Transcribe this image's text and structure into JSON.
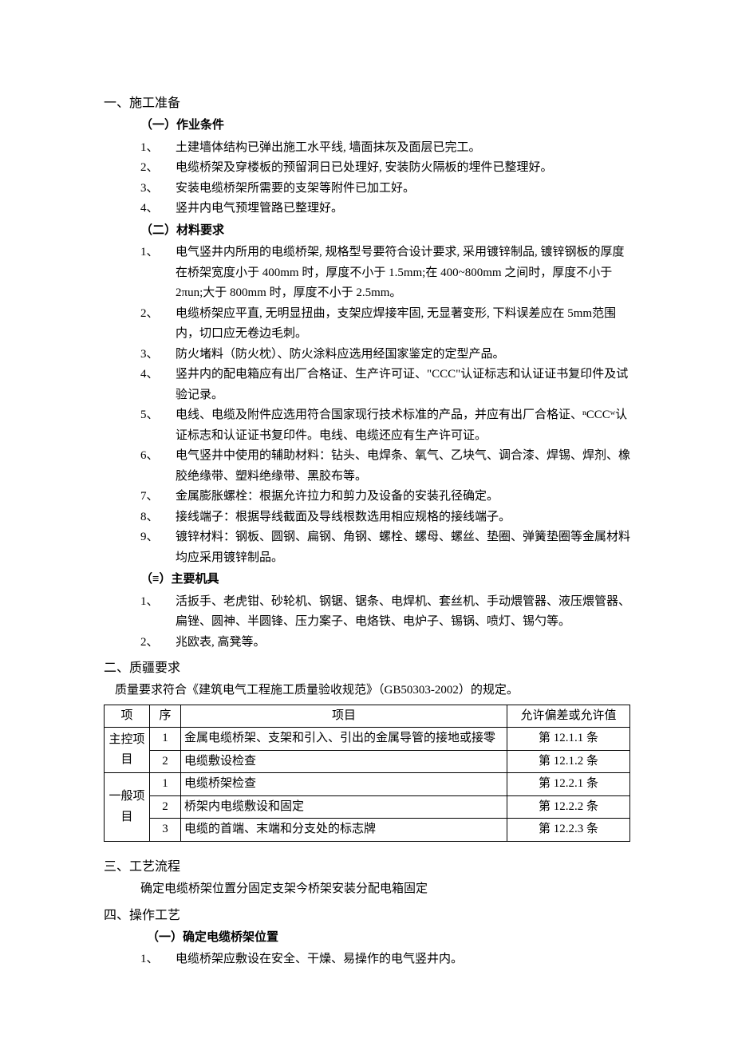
{
  "s1": {
    "title": "一、施工准备",
    "a": {
      "title": "（一）作业条件",
      "items": [
        "土建墙体结构已弹出施工水平线, 墙面抹灰及面层已完工。",
        "电缆桥架及穿楼板的预留洞日已处理好, 安装防火隔板的埋件已整理好。",
        "安装电缆桥架所需要的支架等附件已加工好。",
        "竖井内电气预埋管路已整理好。"
      ]
    },
    "b": {
      "title": "（二）材料要求",
      "items": [
        "电气竖井内所用的电缆桥架, 规格型号要符合设计要求, 采用镀锌制品, 镀锌钢板的厚度在桥架宽度小于 400mm 时，厚度不小于 1.5mm;在 400~800mm 之间时，厚度不小于 2πun;大于 800mm 时，厚度不小于 2.5mm。",
        "电缆桥架应平直, 无明显扭曲，支架应焊接牢固, 无显著变形, 下料误差应在 5mm范围内，切口应无卷边毛刺。",
        "防火堵料（防火枕）、防火涂料应选用经国家鉴定的定型产品。",
        "竖井内的配电箱应有出厂合格证、生产许可证、\"CCC\"认证标志和认证证书复印件及试验记录。",
        "电线、电缆及附件应选用符合国家现行技术标准的产品，并应有出厂合格证、ⁿCCCʷ认证标志和认证证书复印件。电线、电缆还应有生产许可证。",
        "电气竖井中使用的辅助材料：钻头、电焊条、氧气、乙块气、调合漆、焊锡、焊剂、橡胶绝缘带、塑料绝缘带、黑胶布等。",
        "金属膨胀螺栓：根据允许拉力和剪力及设备的安装孔径确定。",
        "接线端子：根据导线截面及导线根数选用相应规格的接线端子。",
        "镀锌材料：钢板、圆钢、扁钢、角钢、螺栓、螺母、螺丝、垫圈、弹簧垫圈等金属材料均应采用镀锌制品。"
      ]
    },
    "c": {
      "title": "（≡）主要机具",
      "items": [
        "活扳手、老虎钳、砂轮机、钢锯、锯条、电焊机、套丝机、手动煨管器、液压煨管器、扁锉、圆神、半圆锋、压力案子、电烙铁、电炉子、锡锅、喷灯、锡勺等。",
        "兆欧表, 高凳等。"
      ]
    }
  },
  "s2": {
    "title": "二、质疆要求",
    "note": "质量要求符合《建筑电气工程施工质量验收规范》（GB50303-2002）的规定。",
    "table": {
      "headers": [
        "项",
        "序",
        "项目",
        "允许偏差或允许值"
      ],
      "groups": [
        {
          "label": "主控项目",
          "rows": [
            [
              "1",
              "金属电缆桥架、支架和引入、引出的金属导管的接地或接零",
              "第 12.1.1 条"
            ],
            [
              "2",
              "电缆敷设检查",
              "第 12.1.2 条"
            ]
          ]
        },
        {
          "label": "一般项目",
          "rows": [
            [
              "1",
              "电缆桥架检查",
              "第 12.2.1 条"
            ],
            [
              "2",
              "桥架内电缆敷设和固定",
              "第 12.2.2 条"
            ],
            [
              "3",
              "电缆的首端、末端和分支处的标志牌",
              "第 12.2.3 条"
            ]
          ]
        }
      ]
    }
  },
  "s3": {
    "title": "三、工艺流程",
    "note": "确定电缆桥架位置分固定支架今桥架安装分配电箱固定"
  },
  "s4": {
    "title": "四、操作工艺",
    "a": {
      "title": "（一）确定电缆桥架位置",
      "items": [
        "电缆桥架应敷设在安全、干燥、易操作的电气竖井内。"
      ]
    }
  }
}
